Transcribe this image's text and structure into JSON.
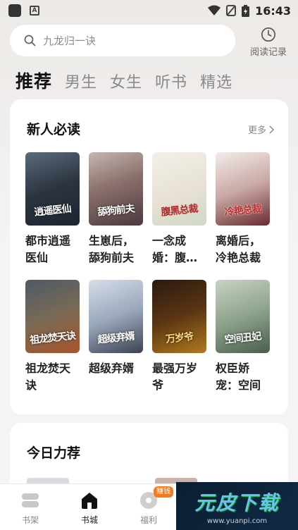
{
  "status_bar": {
    "time": "16:43"
  },
  "search": {
    "placeholder": "九龙归一诀"
  },
  "history": {
    "label": "阅读记录"
  },
  "tabs": [
    {
      "label": "推荐",
      "active": true
    },
    {
      "label": "男生",
      "active": false
    },
    {
      "label": "女生",
      "active": false
    },
    {
      "label": "听书",
      "active": false
    },
    {
      "label": "精选",
      "active": false
    }
  ],
  "section_new": {
    "title": "新人必读",
    "more_label": "更多",
    "books": [
      {
        "title": "都市逍遥医仙",
        "cover_text": "逍遥医仙"
      },
      {
        "title": "生崽后，舔狗前夫",
        "cover_text": "舔狗前夫"
      },
      {
        "title": "一念成婚：腹黑总裁",
        "cover_text": "腹黑总裁"
      },
      {
        "title": "离婚后，冷艳总裁",
        "cover_text": "冷艳总裁"
      },
      {
        "title": "祖龙焚天诀",
        "cover_text": "祖龙焚天诀"
      },
      {
        "title": "超级弃婿",
        "cover_text": "超级弃婿"
      },
      {
        "title": "最强万岁爷",
        "cover_text": "万岁爷"
      },
      {
        "title": "权臣娇宠：空间",
        "cover_text": "空间丑妃"
      }
    ]
  },
  "section_today": {
    "title": "今日力荐"
  },
  "bottom_nav": {
    "items": [
      {
        "label": "书架"
      },
      {
        "label": "书城",
        "active": true
      },
      {
        "label": "福利"
      }
    ],
    "badge": "赚钱"
  },
  "watermark": {
    "brand": "元皮下载",
    "url": "www.yuanpi.com"
  }
}
